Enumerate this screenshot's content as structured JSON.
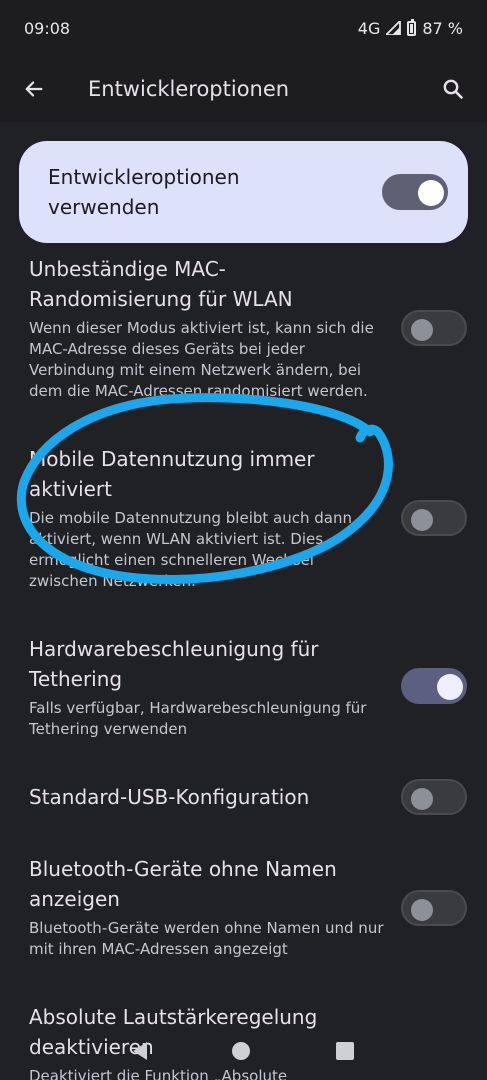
{
  "statusbar": {
    "time": "09:08",
    "network": "4G",
    "battery": "87 %"
  },
  "appbar": {
    "title": "Entwickleroptionen",
    "back_icon": "arrow-left-icon",
    "search_icon": "search-icon"
  },
  "master_toggle": {
    "label": "Entwickleroptionen verwenden",
    "on": true
  },
  "settings": [
    {
      "title": "Unbeständige MAC-Randomisierung für WLAN",
      "summary": "Wenn dieser Modus aktiviert ist, kann sich die MAC-Adresse dieses Geräts bei jeder Verbindung mit einem Netzwerk ändern, bei dem die MAC-Adressen randomisiert werden.",
      "on": false
    },
    {
      "title": "Mobile Datennutzung immer aktiviert",
      "summary": "Die mobile Datennutzung bleibt auch dann aktiviert, wenn WLAN aktiviert ist. Dies ermöglicht einen schnelleren Wechsel zwischen Netzwerken.",
      "on": false
    },
    {
      "title": "Hardwarebeschleunigung für Tethering",
      "summary": "Falls verfügbar, Hardwarebeschleunigung für Tethering verwenden",
      "on": true
    },
    {
      "title": "Standard-USB-Konfiguration",
      "summary": "",
      "on": false
    },
    {
      "title": "Bluetooth-Geräte ohne Namen anzeigen",
      "summary": "Bluetooth-Geräte werden ohne Namen und nur mit ihren MAC-Adressen angezeigt",
      "on": false
    },
    {
      "title": "Absolute Lautstärkeregelung deaktivieren",
      "summary": "Deaktiviert die Funktion „Absolute",
      "on": false
    }
  ],
  "colors": {
    "background": "#202124",
    "card": "#dde1fa",
    "annotation": "#1aa7ec"
  },
  "navbar": {
    "back_icon": "nav-back-icon",
    "home_icon": "nav-home-icon",
    "recents_icon": "nav-recents-icon"
  }
}
